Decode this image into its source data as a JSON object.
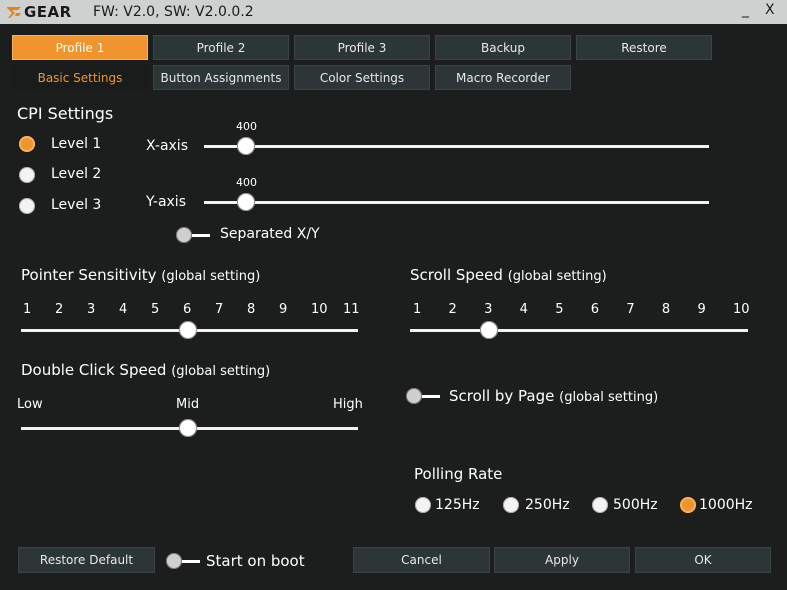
{
  "titlebar": {
    "brand": "GEAR",
    "version": "FW: V2.0, SW: V2.0.0.2",
    "minimize": "_",
    "close": "X"
  },
  "profile_tabs": [
    {
      "label": "Profile 1",
      "active": true
    },
    {
      "label": "Profile 2",
      "active": false
    },
    {
      "label": "Profile 3",
      "active": false
    },
    {
      "label": "Backup",
      "active": false
    },
    {
      "label": "Restore",
      "active": false
    }
  ],
  "sub_tabs": [
    {
      "label": "Basic Settings",
      "active": true
    },
    {
      "label": "Button Assignments",
      "active": false
    },
    {
      "label": "Color Settings",
      "active": false
    },
    {
      "label": "Macro Recorder",
      "active": false
    }
  ],
  "cpi": {
    "title": "CPI Settings",
    "levels": [
      "Level 1",
      "Level 2",
      "Level 3"
    ],
    "selected_level": 1,
    "x_label": "X-axis",
    "x_value": "400",
    "y_label": "Y-axis",
    "y_value": "400",
    "separated_label": "Separated X/Y",
    "separated_on": false
  },
  "pointer": {
    "title": "Pointer Sensitivity",
    "suffix": "(global setting)",
    "ticks": [
      "1",
      "2",
      "3",
      "4",
      "5",
      "6",
      "7",
      "8",
      "9",
      "10",
      "11"
    ],
    "value": 6
  },
  "scroll": {
    "title": "Scroll Speed",
    "suffix": "(global setting)",
    "ticks": [
      "1",
      "2",
      "3",
      "4",
      "5",
      "6",
      "7",
      "8",
      "9",
      "10"
    ],
    "value": 3
  },
  "double_click": {
    "title": "Double Click Speed",
    "suffix": "(global setting)",
    "low": "Low",
    "mid": "Mid",
    "high": "High",
    "value_fraction": 0.5
  },
  "scroll_by_page": {
    "title": "Scroll by Page",
    "suffix": "(global setting)",
    "on": false
  },
  "polling": {
    "title": "Polling Rate",
    "options": [
      "125Hz",
      "250Hz",
      "500Hz",
      "1000Hz"
    ],
    "selected": "1000Hz"
  },
  "footer": {
    "restore_default": "Restore Default",
    "start_on_boot": "Start on boot",
    "start_on_boot_on": false,
    "cancel": "Cancel",
    "apply": "Apply",
    "ok": "OK"
  },
  "colors": {
    "accent": "#f0952e",
    "background": "#1c1e1e",
    "tab": "#2c3636",
    "titlebar": "#cfd1d1"
  }
}
